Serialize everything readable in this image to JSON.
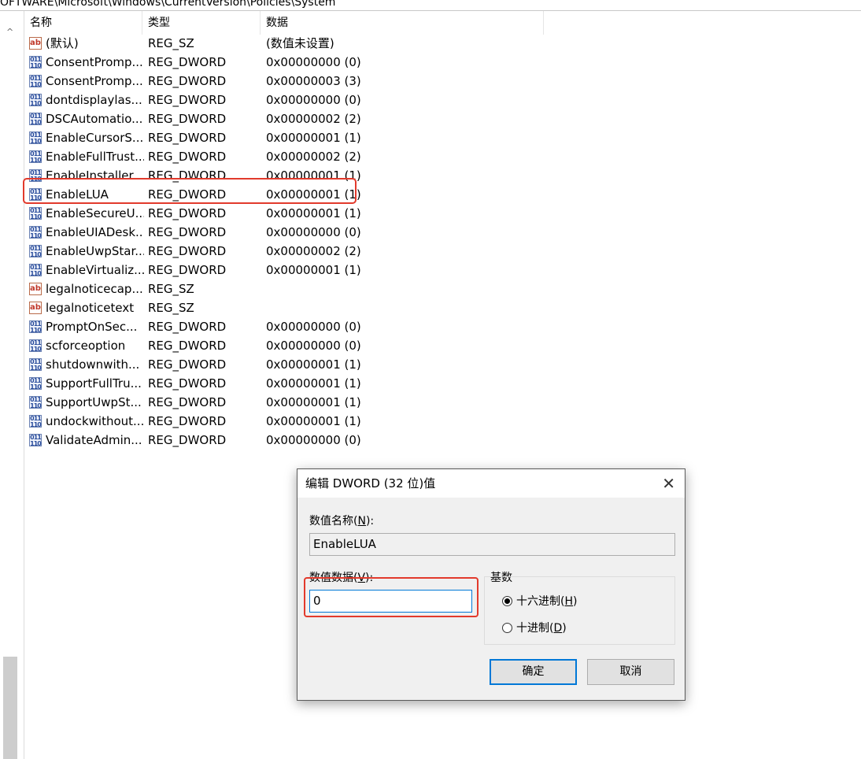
{
  "path": "OFTWARE\\Microsoft\\Windows\\CurrentVersion\\Policies\\System",
  "columns": {
    "name": "名称",
    "type": "类型",
    "data": "数据"
  },
  "rows": [
    {
      "icon": "string",
      "name": "(默认)",
      "type": "REG_SZ",
      "data": "(数值未设置)"
    },
    {
      "icon": "binary",
      "name": "ConsentPromp...",
      "type": "REG_DWORD",
      "data": "0x00000000 (0)"
    },
    {
      "icon": "binary",
      "name": "ConsentPromp...",
      "type": "REG_DWORD",
      "data": "0x00000003 (3)"
    },
    {
      "icon": "binary",
      "name": "dontdisplaylas...",
      "type": "REG_DWORD",
      "data": "0x00000000 (0)"
    },
    {
      "icon": "binary",
      "name": "DSCAutomatio...",
      "type": "REG_DWORD",
      "data": "0x00000002 (2)"
    },
    {
      "icon": "binary",
      "name": "EnableCursorS...",
      "type": "REG_DWORD",
      "data": "0x00000001 (1)"
    },
    {
      "icon": "binary",
      "name": "EnableFullTrust...",
      "type": "REG_DWORD",
      "data": "0x00000002 (2)"
    },
    {
      "icon": "binary",
      "name": "EnableInstaller...",
      "type": "REG_DWORD",
      "data": "0x00000001 (1)"
    },
    {
      "icon": "binary",
      "name": "EnableLUA",
      "type": "REG_DWORD",
      "data": "0x00000001 (1)"
    },
    {
      "icon": "binary",
      "name": "EnableSecureU...",
      "type": "REG_DWORD",
      "data": "0x00000001 (1)"
    },
    {
      "icon": "binary",
      "name": "EnableUIADesk...",
      "type": "REG_DWORD",
      "data": "0x00000000 (0)"
    },
    {
      "icon": "binary",
      "name": "EnableUwpStar...",
      "type": "REG_DWORD",
      "data": "0x00000002 (2)"
    },
    {
      "icon": "binary",
      "name": "EnableVirtualiz...",
      "type": "REG_DWORD",
      "data": "0x00000001 (1)"
    },
    {
      "icon": "string",
      "name": "legalnoticecap...",
      "type": "REG_SZ",
      "data": ""
    },
    {
      "icon": "string",
      "name": "legalnoticetext",
      "type": "REG_SZ",
      "data": ""
    },
    {
      "icon": "binary",
      "name": "PromptOnSec...",
      "type": "REG_DWORD",
      "data": "0x00000000 (0)"
    },
    {
      "icon": "binary",
      "name": "scforceoption",
      "type": "REG_DWORD",
      "data": "0x00000000 (0)"
    },
    {
      "icon": "binary",
      "name": "shutdownwith...",
      "type": "REG_DWORD",
      "data": "0x00000001 (1)"
    },
    {
      "icon": "binary",
      "name": "SupportFullTru...",
      "type": "REG_DWORD",
      "data": "0x00000001 (1)"
    },
    {
      "icon": "binary",
      "name": "SupportUwpSt...",
      "type": "REG_DWORD",
      "data": "0x00000001 (1)"
    },
    {
      "icon": "binary",
      "name": "undockwithout...",
      "type": "REG_DWORD",
      "data": "0x00000001 (1)"
    },
    {
      "icon": "binary",
      "name": "ValidateAdmin...",
      "type": "REG_DWORD",
      "data": "0x00000000 (0)"
    }
  ],
  "icons": {
    "string_text": "ab",
    "binary_top": "011",
    "binary_bottom": "110"
  },
  "dialog": {
    "title": "编辑 DWORD (32 位)值",
    "close": "✕",
    "name_label": "数值名称(",
    "name_label_key": "N",
    "name_label_end": "):",
    "name_value": "EnableLUA",
    "data_label": "数值数据(",
    "data_label_key": "V",
    "data_label_end": "):",
    "data_value": "0",
    "base_label": "基数",
    "hex_label": "十六进制(",
    "hex_key": "H",
    "dec_label": "十进制(",
    "dec_key": "D",
    "paren_close": ")",
    "selected_base": "hex",
    "ok": "确定",
    "cancel": "取消"
  },
  "colors": {
    "highlight": "#e23a2c",
    "focus": "#0078d7"
  }
}
